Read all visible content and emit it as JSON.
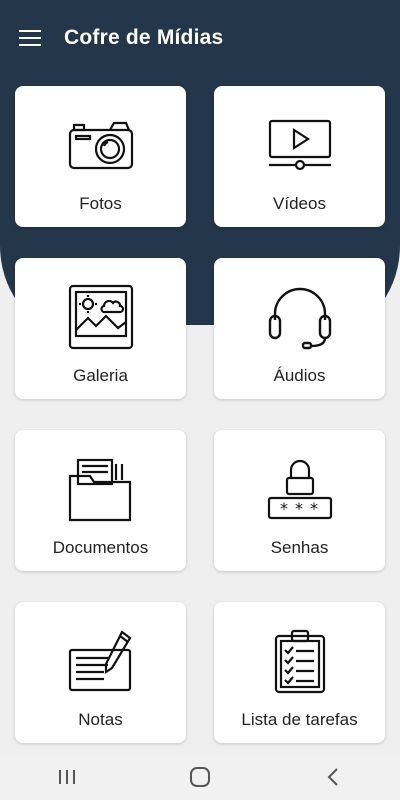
{
  "app": {
    "title": "Cofre de Mídias",
    "accent": "#24364a"
  },
  "header": {
    "menu_icon": "hamburger-menu-icon"
  },
  "categories": [
    {
      "label": "Fotos",
      "icon": "camera-icon"
    },
    {
      "label": "Vídeos",
      "icon": "video-player-icon"
    },
    {
      "label": "Galeria",
      "icon": "gallery-picture-icon"
    },
    {
      "label": "Áudios",
      "icon": "headphones-icon"
    },
    {
      "label": "Documentos",
      "icon": "folder-documents-icon"
    },
    {
      "label": "Senhas",
      "icon": "password-lock-icon"
    },
    {
      "label": "Notas",
      "icon": "notes-pen-icon"
    },
    {
      "label": "Lista de tarefas",
      "icon": "clipboard-checklist-icon"
    }
  ],
  "system_nav": {
    "recents_icon": "recent-apps-icon",
    "home_icon": "home-icon",
    "back_icon": "back-icon"
  }
}
